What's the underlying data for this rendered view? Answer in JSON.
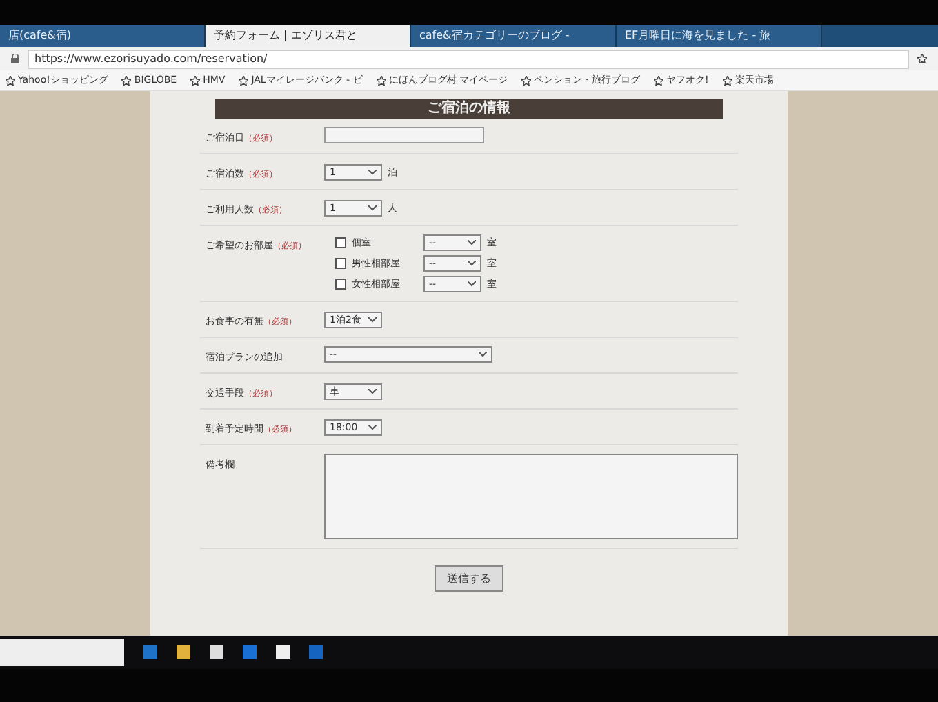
{
  "tabs": [
    {
      "label": "店(cafe&宿)",
      "selected": false
    },
    {
      "label": "予約フォーム | エゾリス君と",
      "selected": true
    },
    {
      "label": "cafe&宿カテゴリーのブログ -",
      "selected": false
    },
    {
      "label": "EF月曜日に海を見ました - 旅",
      "selected": false
    }
  ],
  "address": "https://www.ezorisuyado.com/reservation/",
  "bookmarks": [
    "Yahoo!ショッピング",
    "BIGLOBE",
    "HMV",
    "JALマイレージバンク - ビ",
    "にほんブログ村 マイページ",
    "ペンション・旅行ブログ",
    "ヤフオク!",
    "楽天市場"
  ],
  "section_title": "ご宿泊の情報",
  "fields": [
    {
      "kind": "text",
      "label": "ご宿泊日",
      "required": "（必須）"
    },
    {
      "kind": "select",
      "label": "ご宿泊数",
      "required": "（必須）",
      "value": "1",
      "unit": "泊"
    },
    {
      "kind": "select",
      "label": "ご利用人数",
      "required": "（必須）",
      "value": "1",
      "unit": "人"
    },
    {
      "kind": "rooms",
      "label": "ご希望のお部屋",
      "required": "（必須）",
      "rooms": [
        {
          "name": "個室",
          "checked": false,
          "value": "--",
          "unit": "室"
        },
        {
          "name": "男性相部屋",
          "checked": false,
          "value": "--",
          "unit": "室"
        },
        {
          "name": "女性相部屋",
          "checked": false,
          "value": "--",
          "unit": "室"
        }
      ]
    },
    {
      "kind": "select",
      "label": "お食事の有無",
      "required": "（必須）",
      "value": "1泊2食"
    },
    {
      "kind": "wide",
      "label": "宿泊プランの追加",
      "value": "--"
    },
    {
      "kind": "select",
      "label": "交通手段",
      "required": "（必須）",
      "value": "車"
    },
    {
      "kind": "select",
      "label": "到着予定時間",
      "required": "（必須）",
      "value": "18:00"
    },
    {
      "kind": "textarea",
      "label": "備考欄"
    }
  ],
  "submit": "送信する"
}
